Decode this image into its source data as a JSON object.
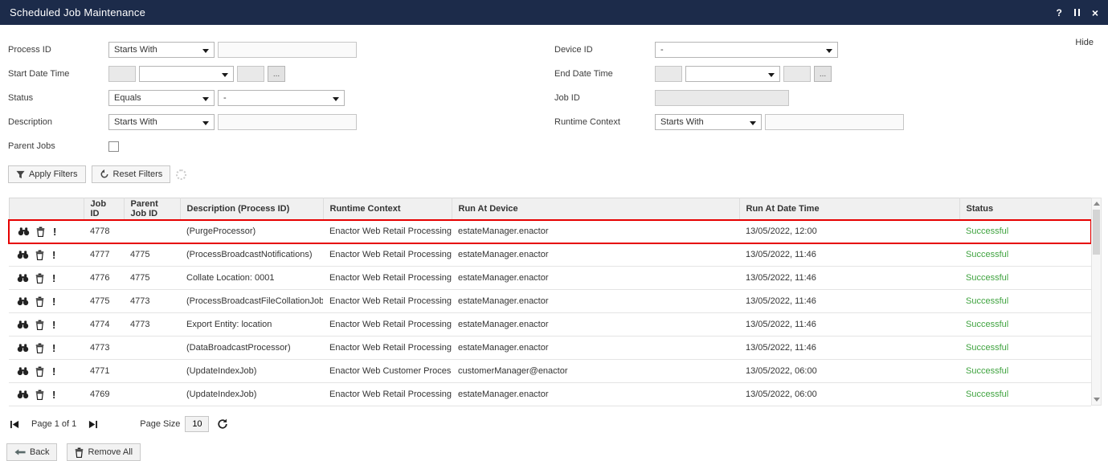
{
  "titlebar": {
    "title": "Scheduled Job Maintenance",
    "help_icon": "?",
    "close_icon": "×"
  },
  "filters": {
    "hide_label": "Hide",
    "process_id": {
      "label": "Process ID",
      "operator": "Starts With",
      "value": ""
    },
    "device_id": {
      "label": "Device ID",
      "selected": "-"
    },
    "start_date_time": {
      "label": "Start Date Time",
      "date_value": "",
      "zone_selected": "",
      "time_value": "",
      "ellipsis_label": "..."
    },
    "end_date_time": {
      "label": "End Date Time",
      "date_value": "",
      "zone_selected": "",
      "time_value": "",
      "ellipsis_label": "..."
    },
    "status": {
      "label": "Status",
      "operator": "Equals",
      "selected": "-"
    },
    "job_id": {
      "label": "Job ID",
      "value": ""
    },
    "description": {
      "label": "Description",
      "operator": "Starts With",
      "value": ""
    },
    "runtime_context": {
      "label": "Runtime Context",
      "operator": "Starts With",
      "value": ""
    },
    "parent_jobs": {
      "label": "Parent Jobs",
      "checked": false
    },
    "apply_label": "Apply Filters",
    "reset_label": "Reset Filters"
  },
  "table": {
    "columns": [
      "Job ID",
      "Parent Job ID",
      "Description (Process ID)",
      "Runtime Context",
      "Run At Device",
      "Run At Date Time",
      "Status"
    ],
    "status_color": "#3fa33f",
    "highlight_color": "#e60000",
    "row_icons": [
      "view",
      "delete",
      "error-log"
    ],
    "rows": [
      {
        "job_id": "4778",
        "parent_job_id": "",
        "description": "(PurgeProcessor)",
        "runtime_context": "Enactor Web Retail Processing",
        "run_at_device": "estateManager.enactor",
        "run_at_date_time": "13/05/2022, 12:00",
        "status": "Successful",
        "highlighted": true
      },
      {
        "job_id": "4777",
        "parent_job_id": "4775",
        "description": "(ProcessBroadcastNotifications)",
        "runtime_context": "Enactor Web Retail Processing",
        "run_at_device": "estateManager.enactor",
        "run_at_date_time": "13/05/2022, 11:46",
        "status": "Successful",
        "highlighted": false
      },
      {
        "job_id": "4776",
        "parent_job_id": "4775",
        "description": "Collate Location: 0001",
        "runtime_context": "Enactor Web Retail Processing",
        "run_at_device": "estateManager.enactor",
        "run_at_date_time": "13/05/2022, 11:46",
        "status": "Successful",
        "highlighted": false
      },
      {
        "job_id": "4775",
        "parent_job_id": "4773",
        "description": "(ProcessBroadcastFileCollationJobs)",
        "runtime_context": "Enactor Web Retail Processing",
        "run_at_device": "estateManager.enactor",
        "run_at_date_time": "13/05/2022, 11:46",
        "status": "Successful",
        "highlighted": false
      },
      {
        "job_id": "4774",
        "parent_job_id": "4773",
        "description": "Export Entity: location",
        "runtime_context": "Enactor Web Retail Processing",
        "run_at_device": "estateManager.enactor",
        "run_at_date_time": "13/05/2022, 11:46",
        "status": "Successful",
        "highlighted": false
      },
      {
        "job_id": "4773",
        "parent_job_id": "",
        "description": "(DataBroadcastProcessor)",
        "runtime_context": "Enactor Web Retail Processing",
        "run_at_device": "estateManager.enactor",
        "run_at_date_time": "13/05/2022, 11:46",
        "status": "Successful",
        "highlighted": false
      },
      {
        "job_id": "4771",
        "parent_job_id": "",
        "description": "(UpdateIndexJob)",
        "runtime_context": "Enactor Web Customer Processing",
        "run_at_device": "customerManager@enactor",
        "run_at_date_time": "13/05/2022, 06:00",
        "status": "Successful",
        "highlighted": false
      },
      {
        "job_id": "4769",
        "parent_job_id": "",
        "description": "(UpdateIndexJob)",
        "runtime_context": "Enactor Web Retail Processing",
        "run_at_device": "estateManager.enactor",
        "run_at_date_time": "13/05/2022, 06:00",
        "status": "Successful",
        "highlighted": false
      }
    ]
  },
  "pagination": {
    "page_label": "Page 1 of 1",
    "page_size_label": "Page Size",
    "page_size": "10"
  },
  "footer": {
    "back_label": "Back",
    "remove_all_label": "Remove All"
  }
}
